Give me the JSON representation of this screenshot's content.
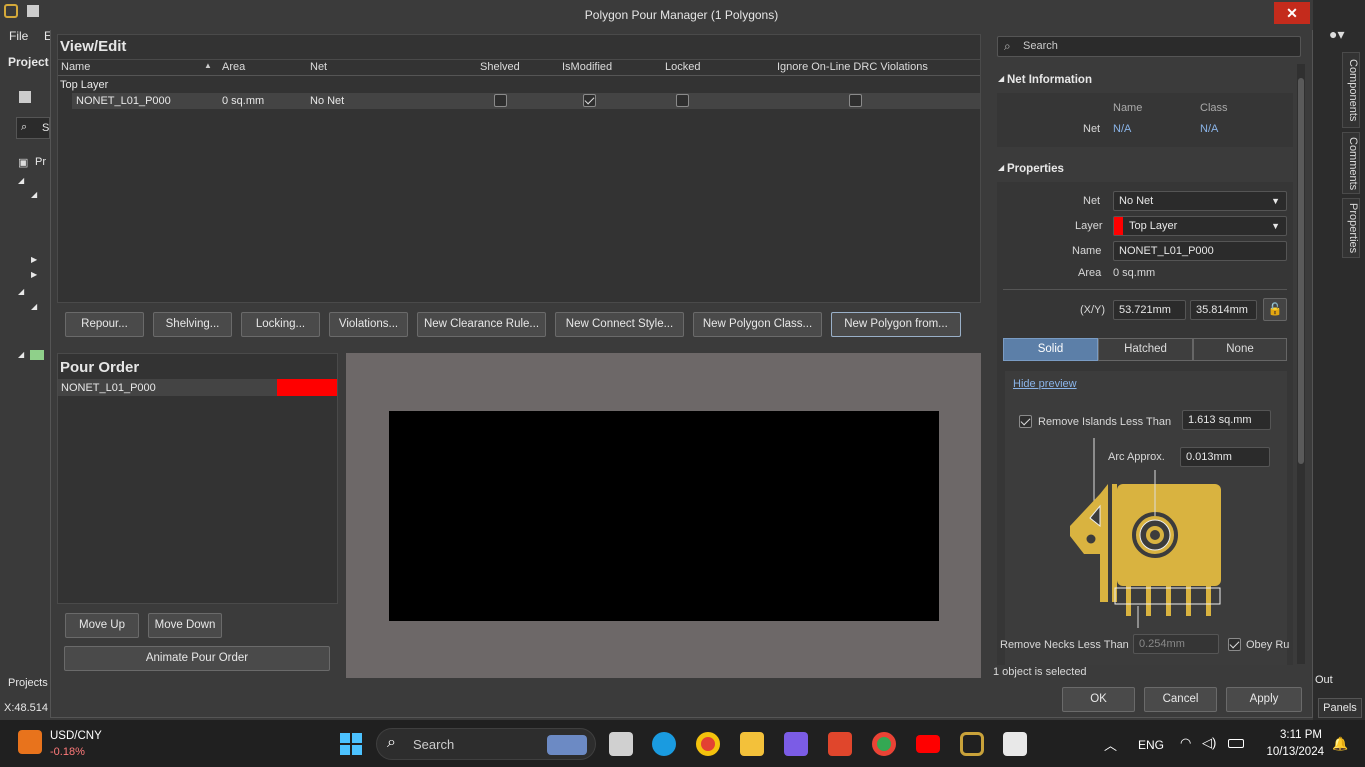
{
  "app": {
    "menu_file": "File",
    "menu_e": "E",
    "project_label": "Project",
    "search_letter": "S",
    "projects_tab": "Projects",
    "coords": "X:48.514",
    "out_label": "Out",
    "panels_label": "Panels",
    "pr_label": "Pr"
  },
  "dialog": {
    "title": "Polygon Pour Manager (1 Polygons)",
    "close": "✕"
  },
  "view_edit": {
    "title": "View/Edit",
    "columns": [
      "Name",
      "Area",
      "Net",
      "Shelved",
      "IsModified",
      "Locked",
      "Ignore On-Line DRC Violations"
    ],
    "group": "Top Layer",
    "row": {
      "name": "NONET_L01_P000",
      "area": "0 sq.mm",
      "net": "No Net",
      "shelved": false,
      "is_modified": true,
      "locked": false,
      "ignore_drc": false
    }
  },
  "actions": [
    "Repour...",
    "Shelving...",
    "Locking...",
    "Violations...",
    "New Clearance Rule...",
    "New Connect Style...",
    "New Polygon Class...",
    "New Polygon from..."
  ],
  "pour_order": {
    "title": "Pour Order",
    "item": "NONET_L01_P000",
    "item_color": "#ff0000",
    "move_up": "Move Up",
    "move_down": "Move Down",
    "animate": "Animate Pour Order"
  },
  "right": {
    "search_placeholder": "Search",
    "net_info": {
      "title": "Net Information",
      "col_name": "Name",
      "col_class": "Class",
      "row_label": "Net",
      "name_val": "N/A",
      "class_val": "N/A"
    },
    "properties": {
      "title": "Properties",
      "net_label": "Net",
      "net_val": "No Net",
      "layer_label": "Layer",
      "layer_val": "Top Layer",
      "layer_color": "#ff0000",
      "name_label": "Name",
      "name_val": "NONET_L01_P000",
      "area_label": "Area",
      "area_val": "0 sq.mm",
      "xy_label": "(X/Y)",
      "x_val": "53.721mm",
      "y_val": "35.814mm"
    },
    "fill_modes": [
      "Solid",
      "Hatched",
      "None"
    ],
    "hide_preview": "Hide preview",
    "remove_islands_label": "Remove Islands Less Than",
    "remove_islands_val": "1.613 sq.mm",
    "arc_label": "Arc Approx.",
    "arc_val": "0.013mm",
    "remove_necks_label": "Remove Necks Less Than",
    "remove_necks_val": "0.254mm",
    "obey_label": "Obey Ru",
    "status": "1 object is selected"
  },
  "footer": {
    "ok": "OK",
    "cancel": "Cancel",
    "apply": "Apply"
  },
  "side_tabs": [
    "Components",
    "Comments",
    "Properties"
  ],
  "taskbar": {
    "ticker": "USD/CNY",
    "change": "-0.18%",
    "search": "Search",
    "lang": "ENG",
    "time": "3:11 PM",
    "date": "10/13/2024"
  }
}
